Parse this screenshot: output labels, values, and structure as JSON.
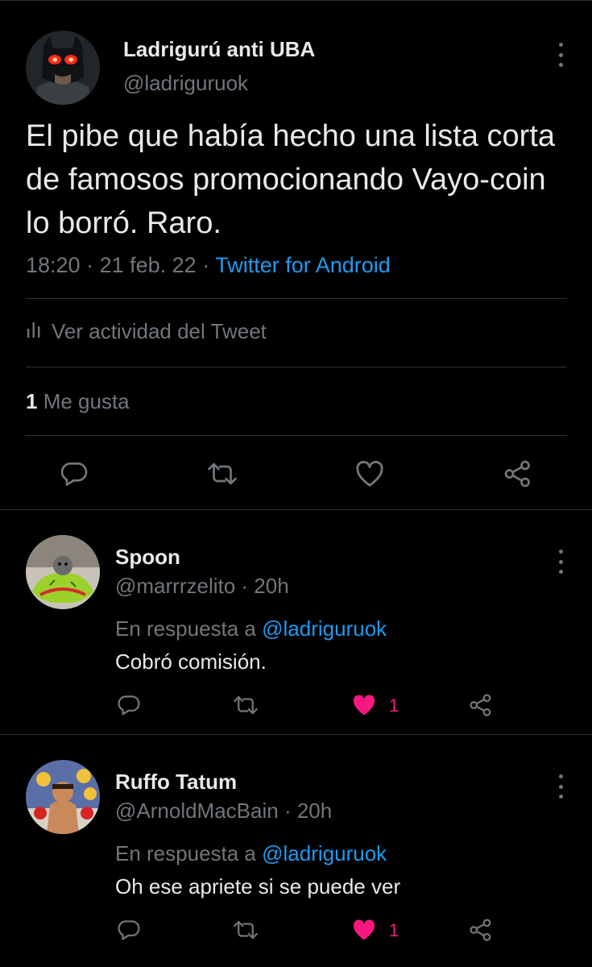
{
  "main_tweet": {
    "author_name": "Ladrigurú anti UBA",
    "author_handle": "@ladriguruok",
    "text": "El pibe que había hecho una lista corta de famosos promocionando Vayo-coin lo borró. Raro.",
    "time": "18:20",
    "date": "21 feb. 22",
    "separator": " · ",
    "source": "Twitter for Android",
    "activity_label": "Ver actividad del Tweet",
    "likes_count": "1",
    "likes_label": " Me gusta"
  },
  "replies": [
    {
      "author_name": "Spoon",
      "author_handle": "@marrrzelito",
      "time": "20h",
      "reply_prefix": "En respuesta a ",
      "reply_mention": "@ladriguruok",
      "text": "Cobró comisión.",
      "like_count": "1"
    },
    {
      "author_name": "Ruffo Tatum",
      "author_handle": "@ArnoldMacBain",
      "time": "20h",
      "reply_prefix": "En respuesta a ",
      "reply_mention": "@ladriguruok",
      "text": "Oh ese apriete si se puede ver",
      "like_count": "1"
    }
  ],
  "colors": {
    "background": "#000000",
    "text_primary": "#e7e9ea",
    "text_secondary": "#71767b",
    "link": "#1d9bf0",
    "like_active": "#f91880",
    "divider": "#2f3336"
  },
  "icons": {
    "reply": "reply-icon",
    "retweet": "retweet-icon",
    "like": "heart-icon",
    "share": "share-icon",
    "more": "more-icon",
    "activity": "bar-chart-icon"
  }
}
